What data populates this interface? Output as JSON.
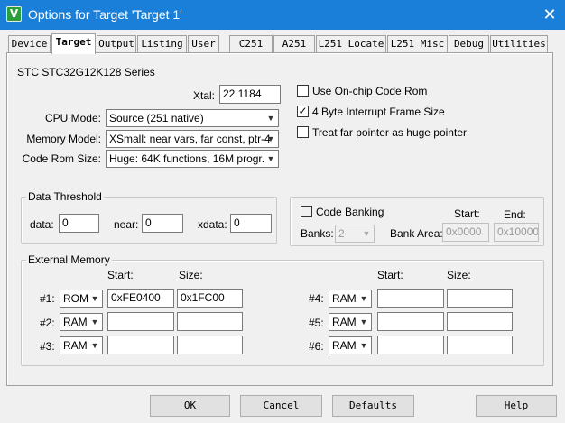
{
  "window": {
    "title": "Options for Target 'Target 1'",
    "icon_letter": "V",
    "close_glyph": "✕"
  },
  "tabs": [
    "Device",
    "Target",
    "Output",
    "Listing",
    "User",
    "C251",
    "A251",
    "L251 Locate",
    "L251 Misc",
    "Debug",
    "Utilities"
  ],
  "target": {
    "device_name": "STC STC32G12K128 Series",
    "xtal_label": "Xtal:",
    "xtal_value": "22.1184",
    "cpu_mode_label": "CPU Mode:",
    "cpu_mode_value": "Source (251 native)",
    "memory_model_label": "Memory Model:",
    "memory_model_value": "XSmall: near vars, far const, ptr-4",
    "code_rom_size_label": "Code Rom Size:",
    "code_rom_size_value": "Huge: 64K functions, 16M progr.",
    "use_onchip_label": "Use On-chip Code Rom",
    "use_onchip_checked": false,
    "interrupt_frame_label": "4 Byte Interrupt Frame Size",
    "interrupt_frame_checked": true,
    "far_pointer_label": "Treat far pointer as huge pointer",
    "far_pointer_checked": false
  },
  "data_threshold": {
    "title": "Data Threshold",
    "data_label": "data:",
    "data_value": "0",
    "near_label": "near:",
    "near_value": "0",
    "xdata_label": "xdata:",
    "xdata_value": "0"
  },
  "banking": {
    "code_banking_label": "Code Banking",
    "code_banking_checked": false,
    "start_header": "Start:",
    "end_header": "End:",
    "banks_label": "Banks:",
    "banks_value": "2",
    "bank_area_label": "Bank Area:",
    "bank_area_start": "0x0000",
    "bank_area_end": "0x10000"
  },
  "external_memory": {
    "title": "External Memory",
    "start_header": "Start:",
    "size_header": "Size:",
    "left_rows": [
      {
        "label": "#1:",
        "type": "ROM",
        "start": "0xFE0400",
        "size": "0x1FC00"
      },
      {
        "label": "#2:",
        "type": "RAM",
        "start": "",
        "size": ""
      },
      {
        "label": "#3:",
        "type": "RAM",
        "start": "",
        "size": ""
      }
    ],
    "right_rows": [
      {
        "label": "#4:",
        "type": "RAM",
        "start": "",
        "size": ""
      },
      {
        "label": "#5:",
        "type": "RAM",
        "start": "",
        "size": ""
      },
      {
        "label": "#6:",
        "type": "RAM",
        "start": "",
        "size": ""
      }
    ]
  },
  "buttons": {
    "ok": "OK",
    "cancel": "Cancel",
    "defaults": "Defaults",
    "help": "Help"
  }
}
